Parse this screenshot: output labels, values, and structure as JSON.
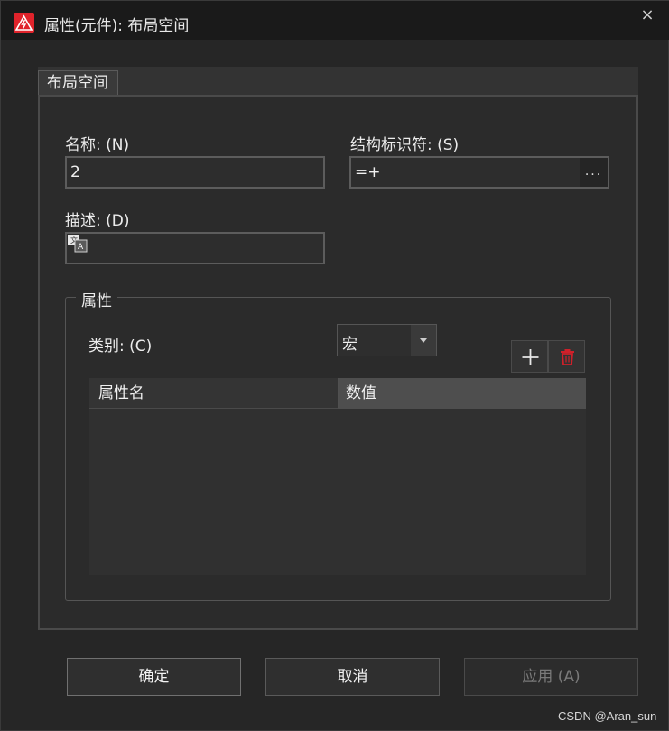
{
  "window": {
    "title": "属性(元件): 布局空间",
    "close_label": "×"
  },
  "tabs": [
    {
      "label": "布局空间"
    }
  ],
  "form": {
    "name_label": "名称: (N)",
    "name_value": "2",
    "structure_label": "结构标识符: (S)",
    "structure_value": "=+",
    "structure_button": "...",
    "description_label": "描述: (D)",
    "description_value": ""
  },
  "properties": {
    "group_title": "属性",
    "category_label": "类别: (C)",
    "category_value": "宏",
    "add_icon": "plus-icon",
    "delete_icon": "trash-icon",
    "columns": [
      "属性名",
      "数值"
    ],
    "rows": []
  },
  "buttons": {
    "ok": "确定",
    "cancel": "取消",
    "apply": "应用 (A)"
  },
  "watermark": "CSDN @Aran_sun",
  "colors": {
    "app_icon": "#e0232b",
    "delete_icon": "#d0202a"
  }
}
